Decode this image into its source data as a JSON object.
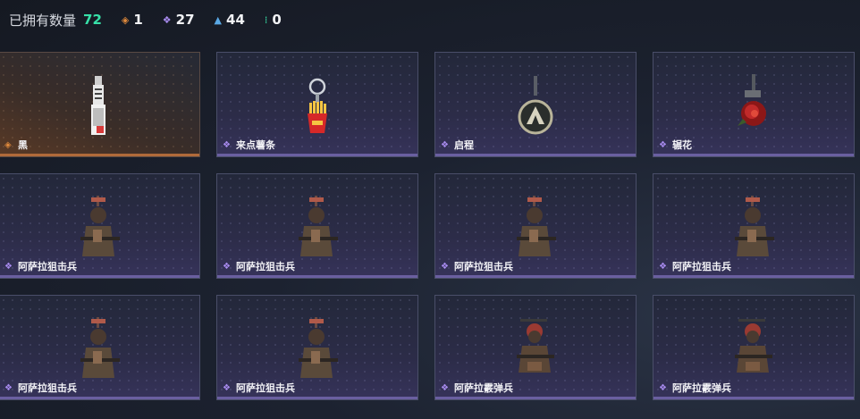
{
  "header": {
    "owned_label": "已拥有数量",
    "owned_count": "72",
    "stats": [
      {
        "icon": "orange-diamond-icon",
        "glyph": "◈",
        "color": "#e08a3c",
        "value": "1"
      },
      {
        "icon": "purple-diamond-icon",
        "glyph": "❖",
        "color": "#a98cf0",
        "value": "27"
      },
      {
        "icon": "blue-chevron-icon",
        "glyph": "▲",
        "color": "#5aa9e6",
        "value": "44"
      },
      {
        "icon": "green-dots-icon",
        "glyph": "⁞",
        "color": "#37e0a8",
        "value": "0"
      }
    ]
  },
  "items": [
    {
      "name": "黑",
      "rarity": "orange",
      "art": "tag-charm"
    },
    {
      "name": "来点薯条",
      "rarity": "purple",
      "art": "fries-charm"
    },
    {
      "name": "启程",
      "rarity": "purple",
      "art": "medal-charm"
    },
    {
      "name": "辗花",
      "rarity": "purple",
      "art": "rose-charm"
    },
    {
      "name": "阿萨拉狙击兵",
      "rarity": "purple",
      "art": "sniper-figure"
    },
    {
      "name": "阿萨拉狙击兵",
      "rarity": "purple",
      "art": "sniper-figure"
    },
    {
      "name": "阿萨拉狙击兵",
      "rarity": "purple",
      "art": "sniper-figure"
    },
    {
      "name": "阿萨拉狙击兵",
      "rarity": "purple",
      "art": "sniper-figure"
    },
    {
      "name": "阿萨拉狙击兵",
      "rarity": "purple",
      "art": "sniper-figure"
    },
    {
      "name": "阿萨拉狙击兵",
      "rarity": "purple",
      "art": "sniper-figure"
    },
    {
      "name": "阿萨拉霰弹兵",
      "rarity": "purple",
      "art": "shotgun-figure"
    },
    {
      "name": "阿萨拉霰弹兵",
      "rarity": "purple",
      "art": "shotgun-figure"
    }
  ]
}
